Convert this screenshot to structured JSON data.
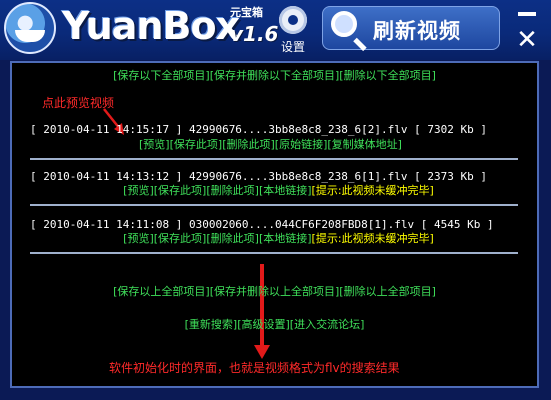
{
  "titlebar": {
    "app_name": "YuanBox",
    "app_name_cn": "元宝箱",
    "version": "v1.6",
    "settings_label": "设置",
    "refresh_label": "刷新视频"
  },
  "top_actions": [
    "[保存以下全部项目]",
    "[保存并删除以下全部项目]",
    "[删除以下全部项目]"
  ],
  "hint_preview": "点此预览视频",
  "items": [
    {
      "time": "[ 2010-04-11 14:15:17 ]",
      "name": "42990676....3bb8e8c8_238_6[2].flv",
      "size": "[ 7302 Kb ]",
      "actions": [
        "[预览]",
        "[保存此项]",
        "[删除此项]",
        "[原始链接]",
        "[复制媒体地址]"
      ],
      "notice": ""
    },
    {
      "time": "[ 2010-04-11 14:13:12 ]",
      "name": "42990676....3bb8e8c8_238_6[1].flv",
      "size": "[ 2373 Kb ]",
      "actions": [
        "[预览]",
        "[保存此项]",
        "[删除此项]",
        "[本地链接]"
      ],
      "notice": "[提示:此视频未缓冲完毕]"
    },
    {
      "time": "[ 2010-04-11 14:11:08 ]",
      "name": "030002060....044CF6F208FBD8[1].flv",
      "size": "[ 4545 Kb ]",
      "actions": [
        "[预览]",
        "[保存此项]",
        "[删除此项]",
        "[本地链接]"
      ],
      "notice": "[提示:此视频未缓冲完毕]"
    }
  ],
  "bottom_actions": [
    "[保存以上全部项目]",
    "[保存并删除以上全部项目]",
    "[删除以上全部项目]"
  ],
  "footer_actions": [
    "[重新搜索]",
    "[高级设置]",
    "[进入交流论坛]"
  ],
  "caption": "软件初始化时的界面，也就是视频格式为flv的搜索结果",
  "colors": {
    "link": "#3fe05a",
    "notice": "#ffff00",
    "annotation": "#ff2a2a",
    "panel_bg": "#000000",
    "titlebar_bg": "#0c2f86"
  },
  "icons": [
    "logo-mascot-icon",
    "gear-icon",
    "magnifier-icon",
    "minimize-icon",
    "close-icon",
    "arrow-icon"
  ]
}
